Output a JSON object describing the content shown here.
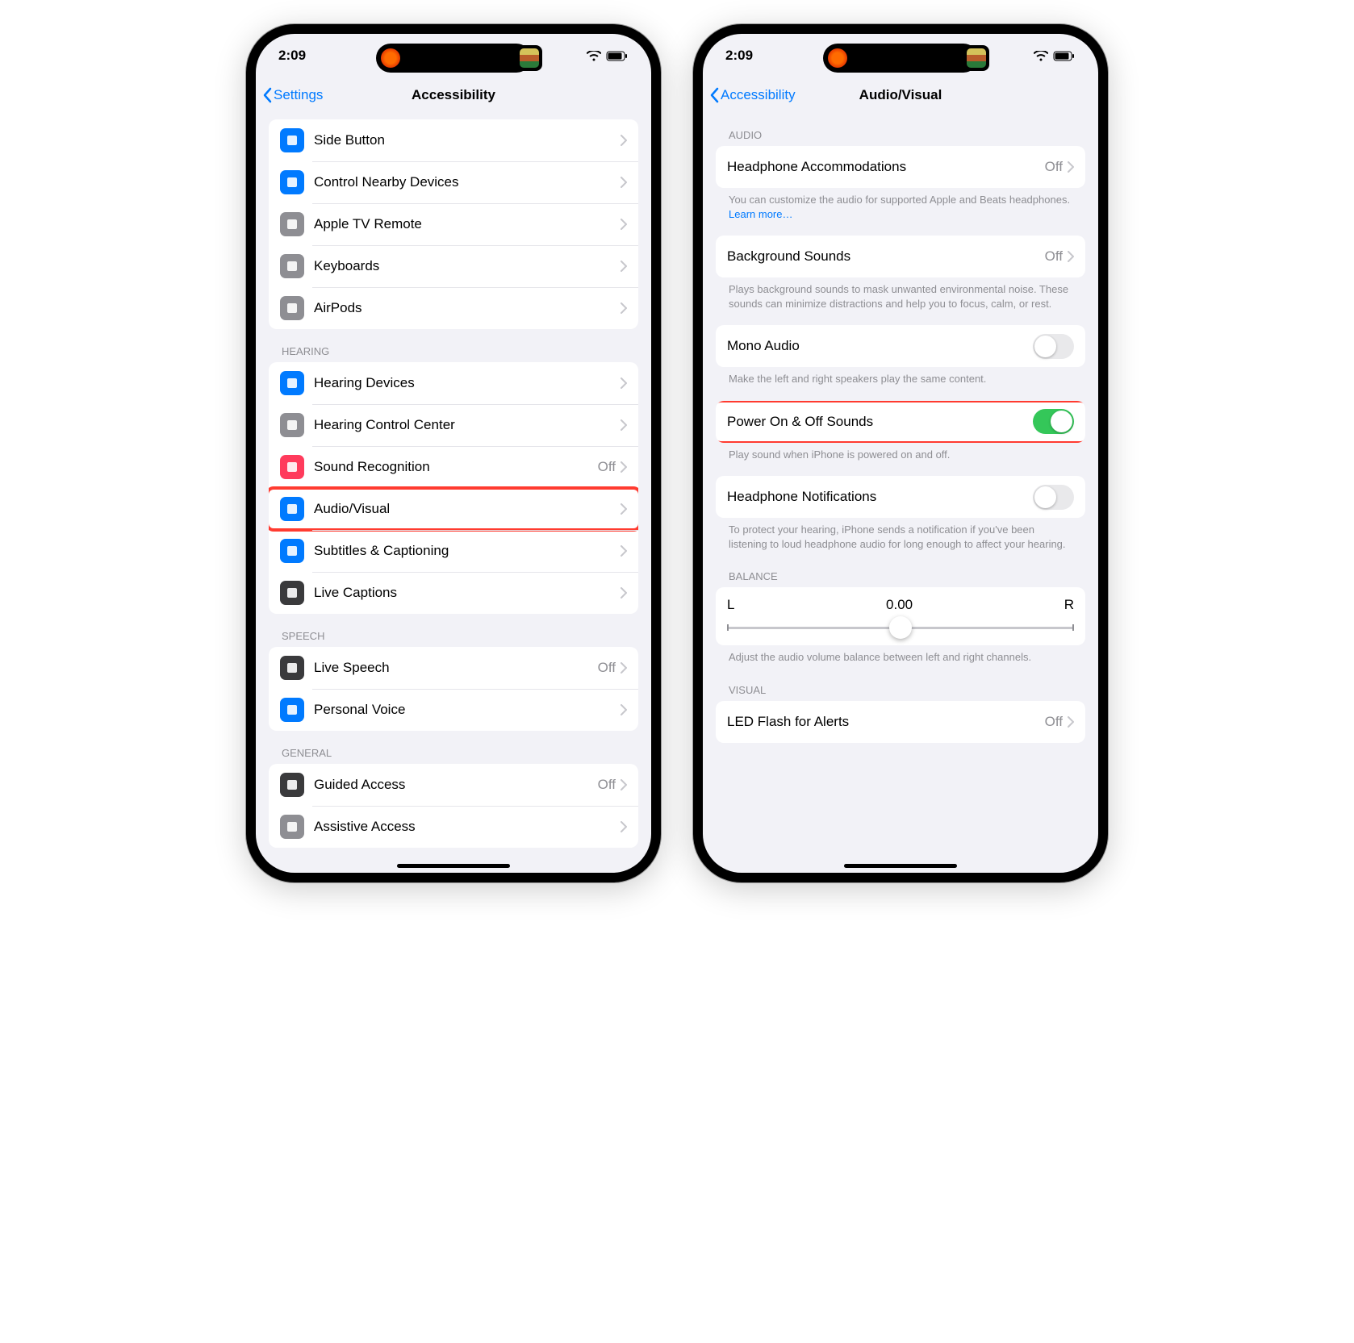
{
  "status": {
    "time": "2:09"
  },
  "left": {
    "back": "Settings",
    "title": "Accessibility",
    "groups": [
      {
        "header": null,
        "rows": [
          {
            "id": "side-button",
            "label": "Side Button",
            "iconColor": "bg-blue"
          },
          {
            "id": "control-nearby",
            "label": "Control Nearby Devices",
            "iconColor": "bg-blue"
          },
          {
            "id": "apple-tv-remote",
            "label": "Apple TV Remote",
            "iconColor": "bg-gray"
          },
          {
            "id": "keyboards",
            "label": "Keyboards",
            "iconColor": "bg-gray"
          },
          {
            "id": "airpods",
            "label": "AirPods",
            "iconColor": "bg-gray"
          }
        ]
      },
      {
        "header": "HEARING",
        "rows": [
          {
            "id": "hearing-devices",
            "label": "Hearing Devices",
            "iconColor": "bg-blue"
          },
          {
            "id": "hearing-control-center",
            "label": "Hearing Control Center",
            "iconColor": "bg-gray"
          },
          {
            "id": "sound-recognition",
            "label": "Sound Recognition",
            "iconColor": "bg-red",
            "value": "Off"
          },
          {
            "id": "audio-visual",
            "label": "Audio/Visual",
            "iconColor": "bg-blue",
            "highlight": true
          },
          {
            "id": "subtitles",
            "label": "Subtitles & Captioning",
            "iconColor": "bg-blue"
          },
          {
            "id": "live-captions",
            "label": "Live Captions",
            "iconColor": "bg-dark"
          }
        ]
      },
      {
        "header": "SPEECH",
        "rows": [
          {
            "id": "live-speech",
            "label": "Live Speech",
            "iconColor": "bg-dark",
            "value": "Off"
          },
          {
            "id": "personal-voice",
            "label": "Personal Voice",
            "iconColor": "bg-blue"
          }
        ]
      },
      {
        "header": "GENERAL",
        "rows": [
          {
            "id": "guided-access",
            "label": "Guided Access",
            "iconColor": "bg-dark",
            "value": "Off"
          },
          {
            "id": "assistive-access",
            "label": "Assistive Access",
            "iconColor": "bg-gray"
          }
        ]
      }
    ]
  },
  "right": {
    "back": "Accessibility",
    "title": "Audio/Visual",
    "sections": [
      {
        "header": "AUDIO",
        "rows": [
          {
            "id": "headphone-accommodations",
            "label": "Headphone Accommodations",
            "value": "Off",
            "disclosure": true
          }
        ],
        "footer": "You can customize the audio for supported Apple and Beats headphones. ",
        "footerLink": "Learn more…"
      },
      {
        "rows": [
          {
            "id": "background-sounds",
            "label": "Background Sounds",
            "value": "Off",
            "disclosure": true
          }
        ],
        "footer": "Plays background sounds to mask unwanted environmental noise. These sounds can minimize distractions and help you to focus, calm, or rest."
      },
      {
        "rows": [
          {
            "id": "mono-audio",
            "label": "Mono Audio",
            "toggle": false
          }
        ],
        "footer": "Make the left and right speakers play the same content."
      },
      {
        "rows": [
          {
            "id": "power-sounds",
            "label": "Power On & Off Sounds",
            "toggle": true,
            "highlight": true
          }
        ],
        "footer": "Play sound when iPhone is powered on and off."
      },
      {
        "rows": [
          {
            "id": "headphone-notifications",
            "label": "Headphone Notifications",
            "toggle": false
          }
        ],
        "footer": "To protect your hearing, iPhone sends a notification if you've been listening to loud headphone audio for long enough to affect your hearing."
      },
      {
        "header": "BALANCE",
        "slider": {
          "left": "L",
          "center": "0.00",
          "right": "R"
        },
        "footer": "Adjust the audio volume balance between left and right channels."
      },
      {
        "header": "VISUAL",
        "rows": [
          {
            "id": "led-flash",
            "label": "LED Flash for Alerts",
            "value": "Off",
            "disclosure": true
          }
        ]
      }
    ]
  }
}
